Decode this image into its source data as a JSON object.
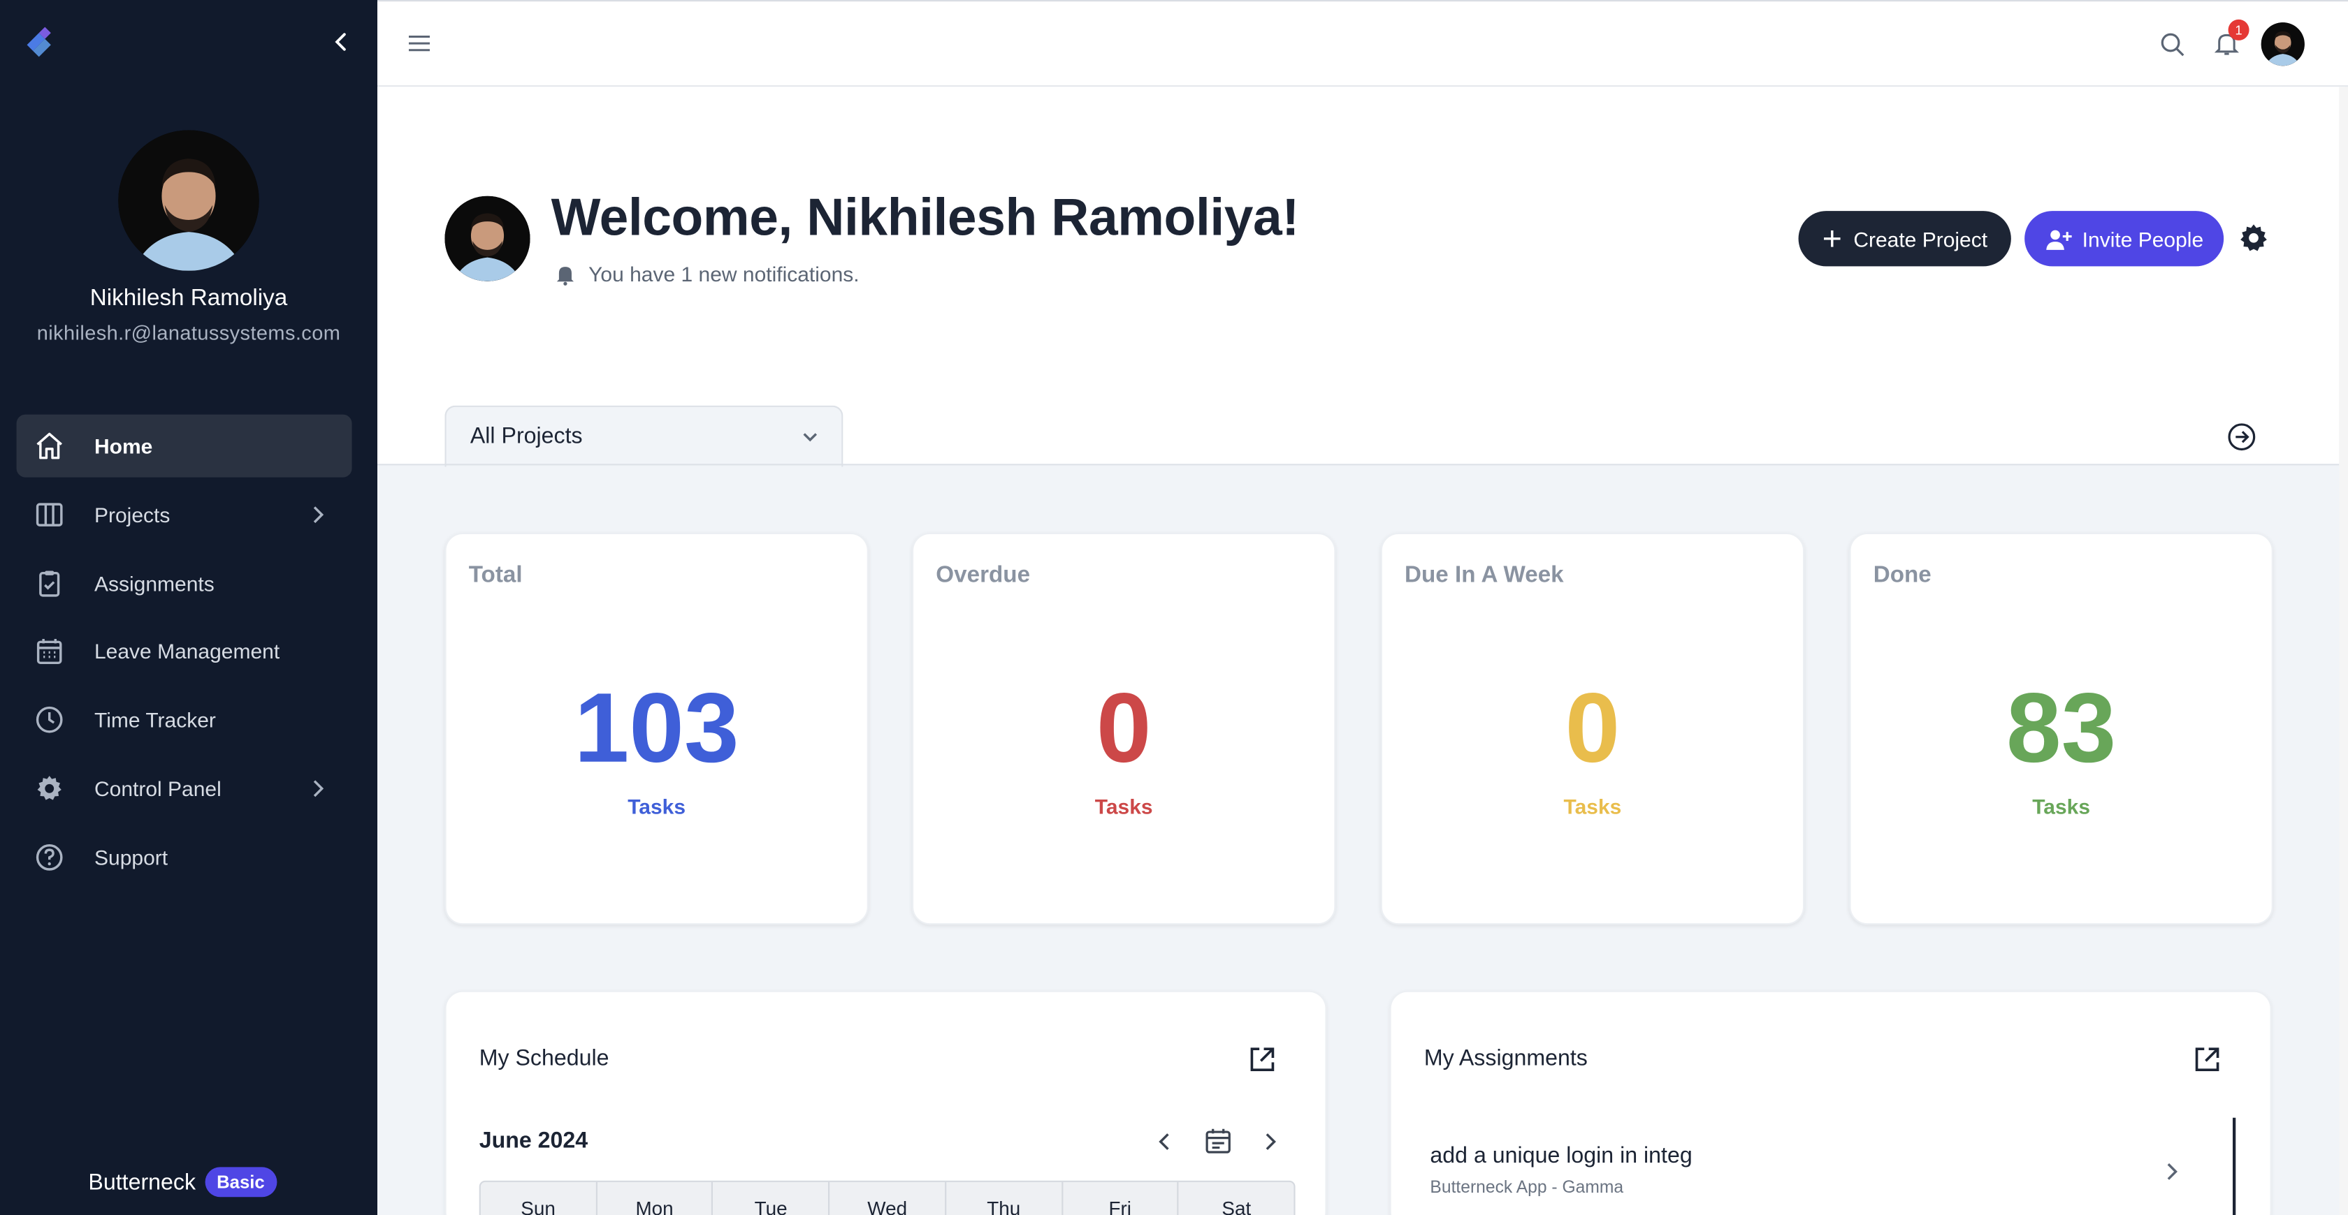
{
  "sidebar": {
    "user_name": "Nikhilesh Ramoliya",
    "user_email": "nikhilesh.r@lanatussystems.com",
    "items": [
      {
        "label": "Home",
        "icon": "home-icon"
      },
      {
        "label": "Projects",
        "icon": "columns-icon"
      },
      {
        "label": "Assignments",
        "icon": "clipboard-check-icon"
      },
      {
        "label": "Leave Management",
        "icon": "calendar-icon"
      },
      {
        "label": "Time Tracker",
        "icon": "clock-icon"
      },
      {
        "label": "Control Panel",
        "icon": "gear-icon"
      },
      {
        "label": "Support",
        "icon": "help-circle-icon"
      }
    ],
    "brand": "Butterneck",
    "plan": "Basic"
  },
  "topbar": {
    "notification_count": "1"
  },
  "header": {
    "welcome": "Welcome, Nikhilesh Ramoliya!",
    "notification_text": "You have 1 new notifications.",
    "create_project": "Create Project",
    "invite_people": "Invite People",
    "project_filter": "All Projects"
  },
  "stats": [
    {
      "title": "Total",
      "value": "103",
      "unit": "Tasks",
      "color": "#3f5fd8"
    },
    {
      "title": "Overdue",
      "value": "0",
      "unit": "Tasks",
      "color": "#cc4848"
    },
    {
      "title": "Due In A Week",
      "value": "0",
      "unit": "Tasks",
      "color": "#e9bd4c"
    },
    {
      "title": "Done",
      "value": "83",
      "unit": "Tasks",
      "color": "#68a659"
    }
  ],
  "schedule": {
    "title": "My Schedule",
    "month": "June 2024",
    "weekdays": [
      "Sun",
      "Mon",
      "Tue",
      "Wed",
      "Thu",
      "Fri",
      "Sat"
    ]
  },
  "assignments": {
    "title": "My Assignments",
    "items": [
      {
        "title": "add a unique login in integ",
        "subtitle": "Butterneck App - Gamma"
      }
    ]
  }
}
